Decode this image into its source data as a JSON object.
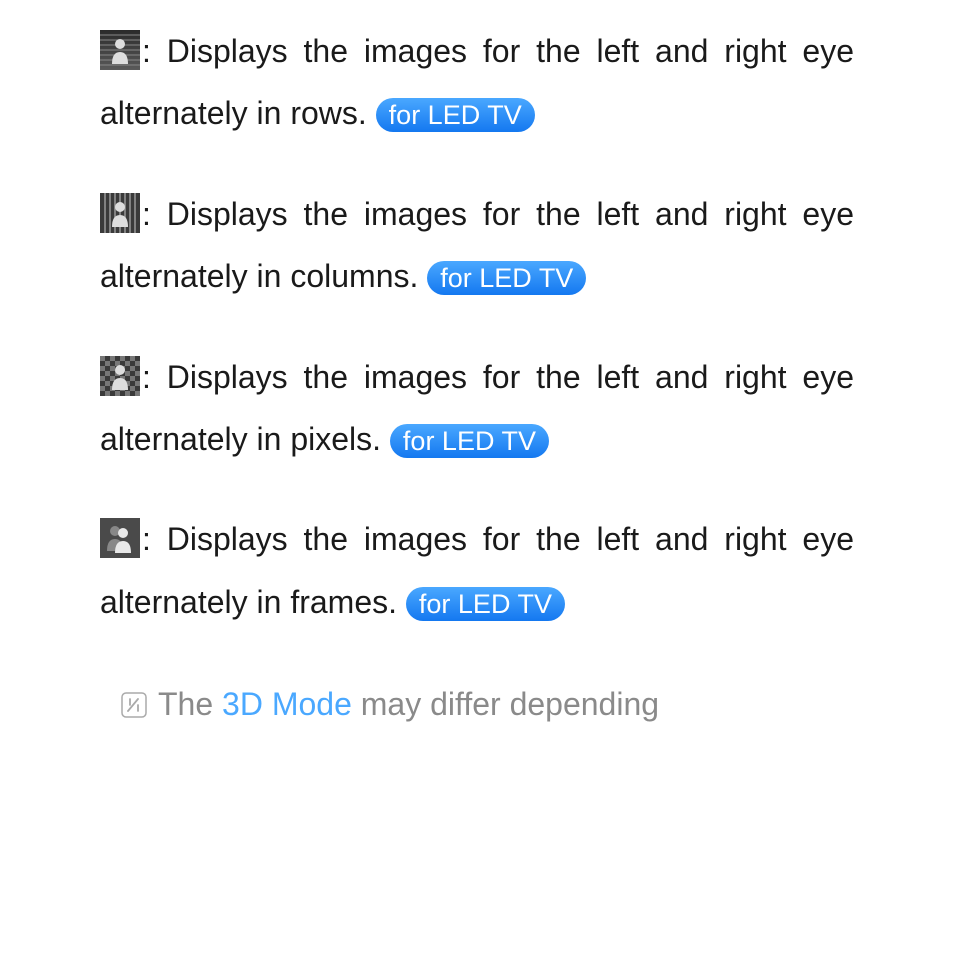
{
  "entries": [
    {
      "text": ": Displays the images for the left and right eye alternately in rows. ",
      "badge": "for LED TV"
    },
    {
      "text": ": Displays the images for the left and right eye alternately in columns. ",
      "badge": "for LED TV"
    },
    {
      "text": ": Displays the images for the left and right eye alternately in pixels. ",
      "badge": "for LED TV"
    },
    {
      "text": ": Displays the images for the left and right eye alternately in frames. ",
      "badge": "for LED TV"
    }
  ],
  "note": {
    "pre": "The ",
    "term": "3D Mode",
    "post": " may differ depending"
  }
}
